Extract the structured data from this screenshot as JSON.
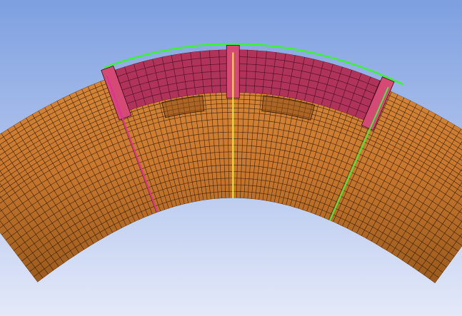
{
  "viewport": {
    "background_top": "#7d9fe0",
    "background_bottom": "#e4e9f9"
  },
  "model": {
    "pipe_color": "#cf7a2f",
    "pipe_shadow_color": "#8e4f18",
    "mesh_line_color": "#2a1505",
    "reinforcement_sleeve_color": "#b0335a",
    "sleeve_top_color": "#d44a75",
    "edge_highlight_green": "#3ef03a",
    "edge_highlight_yellow": "#e4ee2a",
    "edge_highlight_magenta": "#e0309a"
  }
}
